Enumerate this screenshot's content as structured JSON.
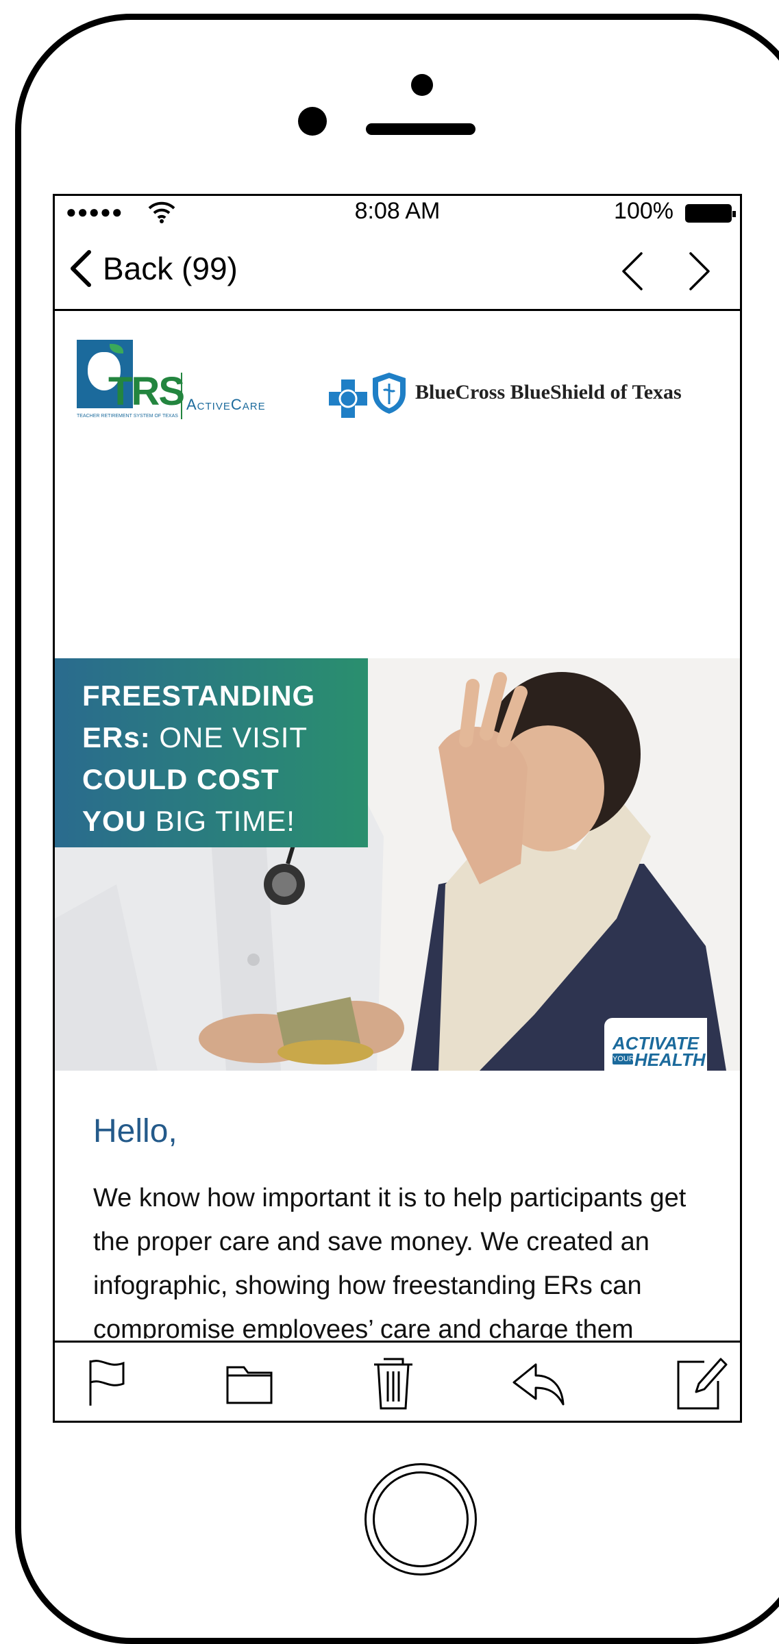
{
  "status_bar": {
    "signal": "●●●●●",
    "time": "8:08 AM",
    "battery": "100%"
  },
  "nav": {
    "back_label": "Back (99)"
  },
  "email": {
    "trs_logo_text": "TRS",
    "trs_product": "ActiveCare",
    "trs_subtitle": "TEACHER RETIREMENT SYSTEM OF TEXAS",
    "bcbs_text": "BlueCross BlueShield of Texas",
    "headline": {
      "l1_bold": "FREESTANDING",
      "l2_bold": "ERs:",
      "l2_thin": " ONE VISIT",
      "l3_bold": "COULD COST",
      "l4_bold": "YOU",
      "l4_thin": " BIG TIME!"
    },
    "badge": {
      "line1": "ACTIVATE",
      "your": "YOUR",
      "line2": "HEALTH"
    },
    "greeting": "Hello,",
    "body": "We know how important it is to help participants get the proper care and save money. We created an infographic, showing how freestanding ERs can compromise employees’ care and charge them exorbitant fees. We’re emailing this infographic to participants today. We include it below for you"
  },
  "toolbar": {
    "icons": [
      "flag-icon",
      "folder-icon",
      "trash-icon",
      "reply-icon",
      "compose-icon"
    ]
  },
  "colors": {
    "accent_blue": "#245a8a",
    "headline_gradient_start": "#2a6b8e",
    "headline_gradient_end": "#2a8f6e",
    "trs_green": "#23853f",
    "trs_blue": "#1b6a9c"
  }
}
